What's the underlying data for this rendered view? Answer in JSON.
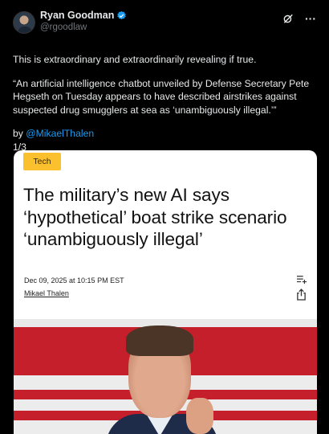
{
  "author": {
    "display_name": "Ryan Goodman",
    "handle": "@rgoodlaw"
  },
  "post": {
    "line1": "This is extraordinary and extraordinarily revealing if true.",
    "quote": "“An artificial intelligence chatbot unveiled by Defense Secretary Pete Hegseth on Tuesday appears to have described airstrikes against suspected drug smugglers at sea as ‘unambiguously illegal.’”",
    "by_prefix": "by ",
    "mention": "@MikaelThalen",
    "counter": "1/3"
  },
  "article": {
    "tag": "Tech",
    "headline": "The military’s new AI says ‘hypothetical’ boat strike scenario ‘unambiguously illegal’",
    "date": "Dec 09, 2025 at 10:15 PM EST",
    "author": "Mikael Thalen"
  },
  "icons": {
    "verified": "verified-badge-icon",
    "grok": "grok-icon",
    "more": "more-icon",
    "list": "add-to-list-icon",
    "share": "share-icon"
  },
  "colors": {
    "background": "#000000",
    "text": "#e7e9ea",
    "muted": "#71767b",
    "link": "#1d9bf0",
    "tag": "#fbc02d",
    "photo_red": "#c61f2c"
  }
}
